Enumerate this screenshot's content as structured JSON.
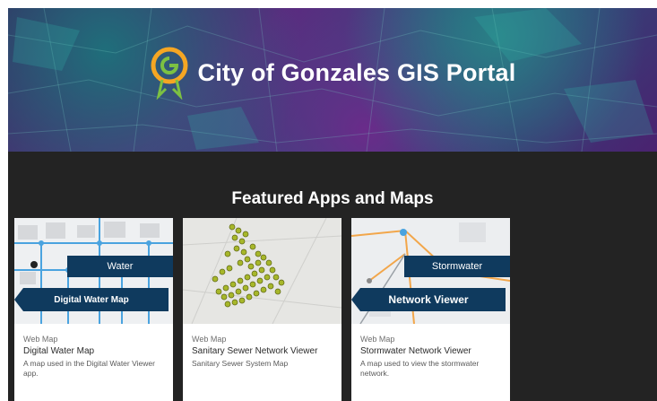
{
  "hero": {
    "title": "City of Gonzales GIS Portal",
    "logo_icon": "gonzales-g-pin-logo"
  },
  "featured": {
    "title": "Featured Apps and Maps",
    "cards": [
      {
        "type": "Web Map",
        "title": "Digital Water Map",
        "description": "A map used in the Digital Water Viewer app.",
        "thumb_top_label": "Water",
        "thumb_main_label": "Digital Water Map"
      },
      {
        "type": "Web Map",
        "title": "Sanitary Sewer Network Viewer",
        "description": "Sanitary Sewer System Map"
      },
      {
        "type": "Web Map",
        "title": "Stormwater Network Viewer",
        "description": "A map used to view the stormwater network.",
        "thumb_top_label": "Stormwater",
        "thumb_main_label": "Network Viewer"
      }
    ]
  },
  "colors": {
    "dark_bg": "#232323",
    "ribbon": "#0f3a5e",
    "logo_orange": "#f5a623",
    "logo_green": "#7cc142"
  }
}
